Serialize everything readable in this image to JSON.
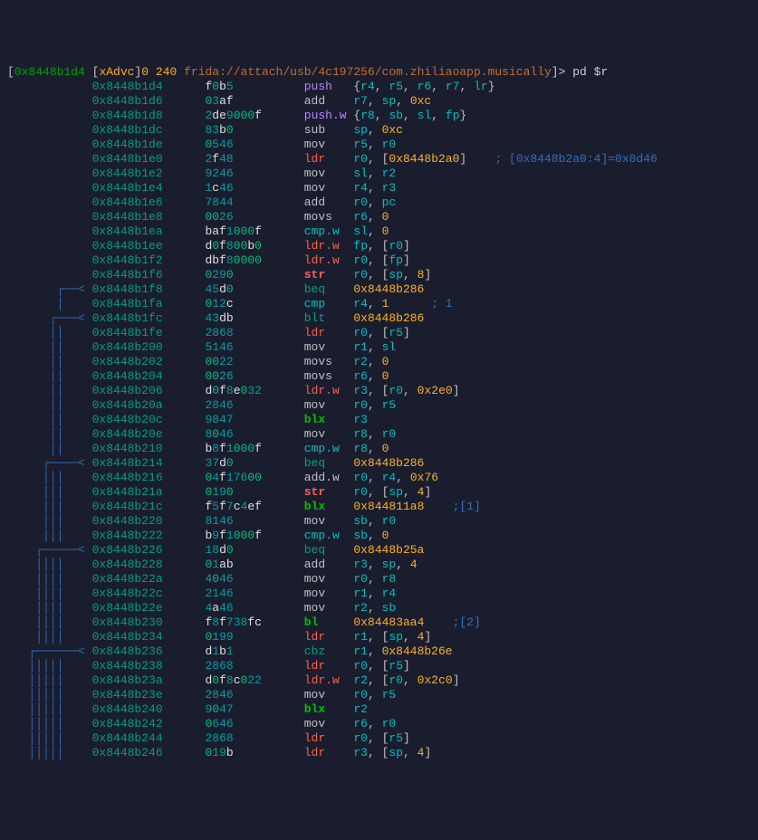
{
  "prompt": {
    "open_bracket": "[",
    "addr": "0x8448b1d4",
    "open_bracket2": "[",
    "xadvc": "xAdvc",
    "close_bracket2": "]",
    "zero": "0",
    "num240": "240",
    "frida": "frida://attach/usb/4c197256/com.zhiliaoapp.musically",
    "close_bracket": "]",
    "angle": ">",
    "cmd": "pd $r"
  },
  "rows": [
    {
      "flow": "            ",
      "addr": "0x8448b1d4",
      "hex": "f0b5",
      "mn": "push",
      "mncls": "mn-push",
      "ops": "{r4, r5, r6, r7, lr}",
      "comment": ""
    },
    {
      "flow": "            ",
      "addr": "0x8448b1d6",
      "hex": "03af",
      "mn": "add",
      "mncls": "mn-add",
      "ops": "r7, sp, 0xc",
      "comment": ""
    },
    {
      "flow": "            ",
      "addr": "0x8448b1d8",
      "hex": "2de9000f",
      "mn": "push.w",
      "mncls": "mn-push",
      "ops": "{r8, sb, sl, fp}",
      "comment": ""
    },
    {
      "flow": "            ",
      "addr": "0x8448b1dc",
      "hex": "83b0",
      "mn": "sub",
      "mncls": "mn-sub",
      "ops": "sp, 0xc",
      "comment": ""
    },
    {
      "flow": "            ",
      "addr": "0x8448b1de",
      "hex": "0546",
      "mn": "mov",
      "mncls": "mn-mov",
      "ops": "r5, r0",
      "comment": ""
    },
    {
      "flow": "            ",
      "addr": "0x8448b1e0",
      "hex": "2f48",
      "mn": "ldr",
      "mncls": "mn-ldr",
      "ops": "r0, [0x8448b2a0]",
      "comment": "; [0x8448b2a0:4]=0x8d46"
    },
    {
      "flow": "            ",
      "addr": "0x8448b1e2",
      "hex": "9246",
      "mn": "mov",
      "mncls": "mn-mov",
      "ops": "sl, r2",
      "comment": ""
    },
    {
      "flow": "            ",
      "addr": "0x8448b1e4",
      "hex": "1c46",
      "mn": "mov",
      "mncls": "mn-mov",
      "ops": "r4, r3",
      "comment": ""
    },
    {
      "flow": "            ",
      "addr": "0x8448b1e6",
      "hex": "7844",
      "mn": "add",
      "mncls": "mn-add",
      "ops": "r0, pc",
      "comment": ""
    },
    {
      "flow": "            ",
      "addr": "0x8448b1e8",
      "hex": "0026",
      "mn": "movs",
      "mncls": "mn-movs",
      "ops": "r6, 0",
      "comment": ""
    },
    {
      "flow": "            ",
      "addr": "0x8448b1ea",
      "hex": "baf1000f",
      "mn": "cmp.w",
      "mncls": "mn-cmp",
      "ops": "sl, 0",
      "comment": ""
    },
    {
      "flow": "            ",
      "addr": "0x8448b1ee",
      "hex": "d0f800b0",
      "mn": "ldr.w",
      "mncls": "mn-ldr",
      "ops": "fp, [r0]",
      "comment": ""
    },
    {
      "flow": "            ",
      "addr": "0x8448b1f2",
      "hex": "dbf80000",
      "mn": "ldr.w",
      "mncls": "mn-ldr",
      "ops": "r0, [fp]",
      "comment": ""
    },
    {
      "flow": "            ",
      "addr": "0x8448b1f6",
      "hex": "0290",
      "mn": "str",
      "mncls": "mn-str",
      "ops": "r0, [sp, 8]",
      "comment": ""
    },
    {
      "flow": "       ┌──< ",
      "addr": "0x8448b1f8",
      "hex": "45d0",
      "mn": "beq",
      "mncls": "mn-beq",
      "ops": "0x8448b286",
      "comment": ""
    },
    {
      "flow": "       │    ",
      "addr": "0x8448b1fa",
      "hex": "012c",
      "mn": "cmp",
      "mncls": "mn-cmp",
      "ops": "r4, 1",
      "comment": "; 1"
    },
    {
      "flow": "      ┌───< ",
      "addr": "0x8448b1fc",
      "hex": "43db",
      "mn": "blt",
      "mncls": "mn-blt",
      "ops": "0x8448b286",
      "comment": ""
    },
    {
      "flow": "      ││    ",
      "addr": "0x8448b1fe",
      "hex": "2868",
      "mn": "ldr",
      "mncls": "mn-ldr",
      "ops": "r0, [r5]",
      "comment": ""
    },
    {
      "flow": "      ││    ",
      "addr": "0x8448b200",
      "hex": "5146",
      "mn": "mov",
      "mncls": "mn-mov",
      "ops": "r1, sl",
      "comment": ""
    },
    {
      "flow": "      ││    ",
      "addr": "0x8448b202",
      "hex": "0022",
      "mn": "movs",
      "mncls": "mn-movs",
      "ops": "r2, 0",
      "comment": ""
    },
    {
      "flow": "      ││    ",
      "addr": "0x8448b204",
      "hex": "0026",
      "mn": "movs",
      "mncls": "mn-movs",
      "ops": "r6, 0",
      "comment": ""
    },
    {
      "flow": "      ││    ",
      "addr": "0x8448b206",
      "hex": "d0f8e032",
      "mn": "ldr.w",
      "mncls": "mn-ldr",
      "ops": "r3, [r0, 0x2e0]",
      "comment": ""
    },
    {
      "flow": "      ││    ",
      "addr": "0x8448b20a",
      "hex": "2846",
      "mn": "mov",
      "mncls": "mn-mov",
      "ops": "r0, r5",
      "comment": ""
    },
    {
      "flow": "      ││    ",
      "addr": "0x8448b20c",
      "hex": "9847",
      "mn": "blx",
      "mncls": "mn-blx",
      "ops": "r3",
      "comment": ""
    },
    {
      "flow": "      ││    ",
      "addr": "0x8448b20e",
      "hex": "8046",
      "mn": "mov",
      "mncls": "mn-mov",
      "ops": "r8, r0",
      "comment": ""
    },
    {
      "flow": "      ││    ",
      "addr": "0x8448b210",
      "hex": "b8f1000f",
      "mn": "cmp.w",
      "mncls": "mn-cmp",
      "ops": "r8, 0",
      "comment": ""
    },
    {
      "flow": "     ┌────< ",
      "addr": "0x8448b214",
      "hex": "37d0",
      "mn": "beq",
      "mncls": "mn-beq",
      "ops": "0x8448b286",
      "comment": ""
    },
    {
      "flow": "     │││    ",
      "addr": "0x8448b216",
      "hex": "04f17600",
      "mn": "add.w",
      "mncls": "mn-add",
      "ops": "r0, r4, 0x76",
      "comment": ""
    },
    {
      "flow": "     │││    ",
      "addr": "0x8448b21a",
      "hex": "0190",
      "mn": "str",
      "mncls": "mn-str",
      "ops": "r0, [sp, 4]",
      "comment": ""
    },
    {
      "flow": "     │││    ",
      "addr": "0x8448b21c",
      "hex": "f5f7c4ef",
      "mn": "blx",
      "mncls": "mn-blx",
      "ops": "0x844811a8",
      "comment": ";[1]"
    },
    {
      "flow": "     │││    ",
      "addr": "0x8448b220",
      "hex": "8146",
      "mn": "mov",
      "mncls": "mn-mov",
      "ops": "sb, r0",
      "comment": ""
    },
    {
      "flow": "     │││    ",
      "addr": "0x8448b222",
      "hex": "b9f1000f",
      "mn": "cmp.w",
      "mncls": "mn-cmp",
      "ops": "sb, 0",
      "comment": ""
    },
    {
      "flow": "    ┌─────< ",
      "addr": "0x8448b226",
      "hex": "18d0",
      "mn": "beq",
      "mncls": "mn-beq",
      "ops": "0x8448b25a",
      "comment": ""
    },
    {
      "flow": "    ││││    ",
      "addr": "0x8448b228",
      "hex": "01ab",
      "mn": "add",
      "mncls": "mn-add",
      "ops": "r3, sp, 4",
      "comment": ""
    },
    {
      "flow": "    ││││    ",
      "addr": "0x8448b22a",
      "hex": "4046",
      "mn": "mov",
      "mncls": "mn-mov",
      "ops": "r0, r8",
      "comment": ""
    },
    {
      "flow": "    ││││    ",
      "addr": "0x8448b22c",
      "hex": "2146",
      "mn": "mov",
      "mncls": "mn-mov",
      "ops": "r1, r4",
      "comment": ""
    },
    {
      "flow": "    ││││    ",
      "addr": "0x8448b22e",
      "hex": "4a46",
      "mn": "mov",
      "mncls": "mn-mov",
      "ops": "r2, sb",
      "comment": ""
    },
    {
      "flow": "    ││││    ",
      "addr": "0x8448b230",
      "hex": "f8f738fc",
      "mn": "bl",
      "mncls": "mn-bl",
      "ops": "0x84483aa4",
      "comment": ";[2]"
    },
    {
      "flow": "    ││││    ",
      "addr": "0x8448b234",
      "hex": "0199",
      "mn": "ldr",
      "mncls": "mn-ldr",
      "ops": "r1, [sp, 4]",
      "comment": ""
    },
    {
      "flow": "   ┌──────< ",
      "addr": "0x8448b236",
      "hex": "d1b1",
      "mn": "cbz",
      "mncls": "mn-cbz",
      "ops": "r1, 0x8448b26e",
      "comment": ""
    },
    {
      "flow": "   │││││    ",
      "addr": "0x8448b238",
      "hex": "2868",
      "mn": "ldr",
      "mncls": "mn-ldr",
      "ops": "r0, [r5]",
      "comment": ""
    },
    {
      "flow": "   │││││    ",
      "addr": "0x8448b23a",
      "hex": "d0f8c022",
      "mn": "ldr.w",
      "mncls": "mn-ldr",
      "ops": "r2, [r0, 0x2c0]",
      "comment": ""
    },
    {
      "flow": "   │││││    ",
      "addr": "0x8448b23e",
      "hex": "2846",
      "mn": "mov",
      "mncls": "mn-mov",
      "ops": "r0, r5",
      "comment": ""
    },
    {
      "flow": "   │││││    ",
      "addr": "0x8448b240",
      "hex": "9047",
      "mn": "blx",
      "mncls": "mn-blx",
      "ops": "r2",
      "comment": ""
    },
    {
      "flow": "   │││││    ",
      "addr": "0x8448b242",
      "hex": "0646",
      "mn": "mov",
      "mncls": "mn-mov",
      "ops": "r6, r0",
      "comment": ""
    },
    {
      "flow": "   │││││    ",
      "addr": "0x8448b244",
      "hex": "2868",
      "mn": "ldr",
      "mncls": "mn-ldr",
      "ops": "r0, [r5]",
      "comment": ""
    },
    {
      "flow": "   │││││    ",
      "addr": "0x8448b246",
      "hex": "019b",
      "mn": "ldr",
      "mncls": "mn-ldr",
      "ops": "r3, [sp, 4]",
      "comment": ""
    }
  ]
}
